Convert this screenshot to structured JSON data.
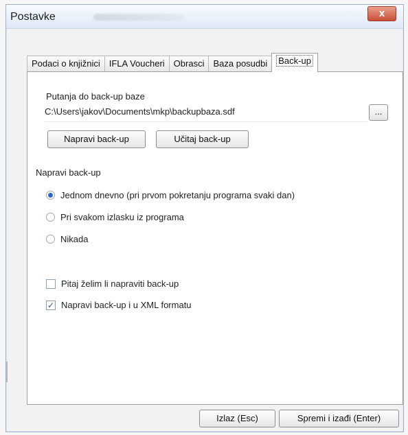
{
  "window": {
    "title": "Postavke",
    "close_label": "x"
  },
  "tabs": [
    {
      "label": "Podaci o knjižnici"
    },
    {
      "label": "IFLA Voucheri"
    },
    {
      "label": "Obrasci"
    },
    {
      "label": "Baza posudbi"
    },
    {
      "label": "Back-up"
    }
  ],
  "backup": {
    "path_label": "Putanja do back-up baze",
    "path_value": "C:\\Users\\jakov\\Documents\\mkp\\backupbaza.sdf",
    "browse_label": "...",
    "make_backup_button": "Napravi back-up",
    "load_backup_button": "Učitaj back-up",
    "section_label": "Napravi back-up",
    "radio_options": [
      {
        "label": "Jednom dnevno (pri prvom pokretanju programa svaki dan)",
        "checked": true
      },
      {
        "label": "Pri svakom izlasku iz programa",
        "checked": false
      },
      {
        "label": "Nikada",
        "checked": false
      }
    ],
    "checkboxes": [
      {
        "label": "Pitaj želim li napraviti back-up",
        "checked": false
      },
      {
        "label": "Napravi back-up i u XML formatu",
        "checked": true
      }
    ]
  },
  "footer": {
    "exit_button": "Izlaz (Esc)",
    "save_button": "Spremi i izađi (Enter)"
  }
}
